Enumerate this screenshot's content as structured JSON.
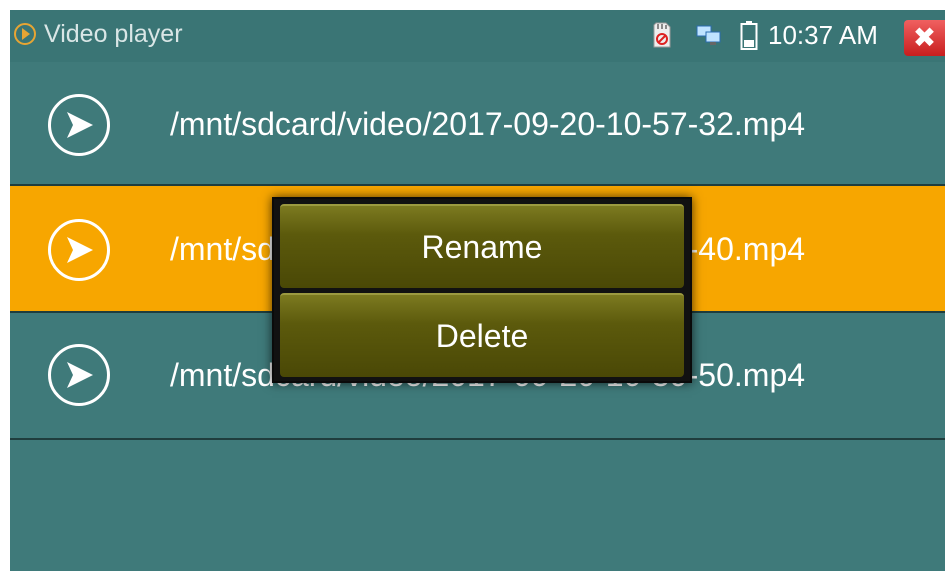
{
  "statusbar": {
    "app_title": "Video player",
    "clock": "10:37 AM",
    "close_symbol": "✖",
    "icons": [
      "app-play-icon",
      "sd-card-icon",
      "network-icon",
      "battery-icon",
      "close-icon"
    ]
  },
  "files": [
    {
      "name": "/mnt/sdcard/video/2017-09-20-10-57-32.mp4",
      "selected": false
    },
    {
      "name": "/mnt/sdcard/video/2017-09-20-10-57-40.mp4",
      "selected": true
    },
    {
      "name": "/mnt/sdcard/video/2017-09-20-10-59-50.mp4",
      "selected": false
    }
  ],
  "context_menu": {
    "rename_label": "Rename",
    "delete_label": "Delete"
  },
  "colors": {
    "background": "#3f7a7a",
    "selected_row": "#f7a600",
    "menu_item": "#5c5a0c"
  }
}
